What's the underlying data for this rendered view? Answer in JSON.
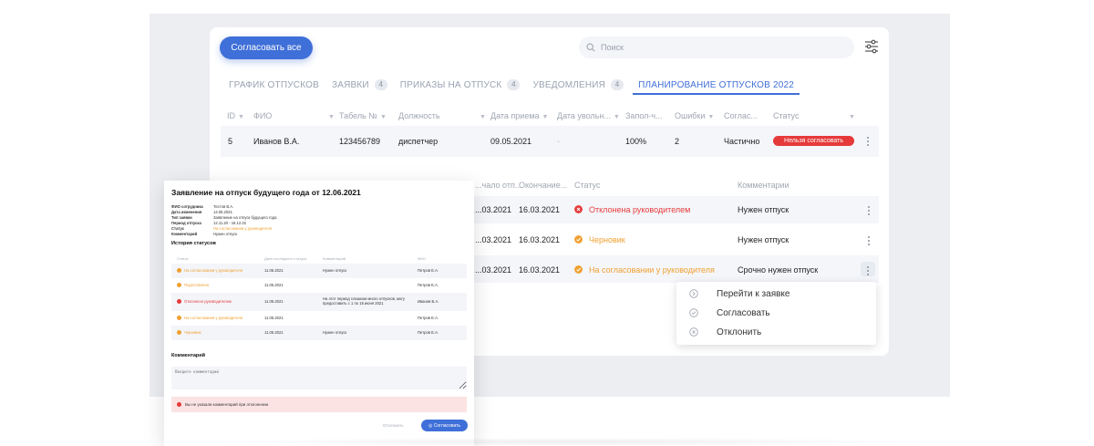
{
  "colors": {
    "accent": "#3f6fd8",
    "danger": "#e63a3a",
    "warning": "#f0a030",
    "stage_bg": "#eceef2"
  },
  "toolbar": {
    "approve_all_label": "Согласовать все",
    "search_placeholder": "Поиск",
    "filter_icon": "filter-sliders-icon"
  },
  "tabs": [
    {
      "label": "ГРАФИК ОТПУСКОВ",
      "badge": ""
    },
    {
      "label": "ЗАЯВКИ",
      "badge": "4"
    },
    {
      "label": "ПРИКАЗЫ НА ОТПУСК",
      "badge": "4"
    },
    {
      "label": "УВЕДОМЛЕНИЯ",
      "badge": "4"
    },
    {
      "label": "ПЛАНИРОВАНИЕ ОТПУСКОВ 2022",
      "badge": ""
    }
  ],
  "table": {
    "headers": [
      "ID",
      "ФИО",
      "Табель №",
      "Должность",
      "Дата приема",
      "Дата увольн...",
      "Запол-ч...",
      "Ошибки",
      "Соглас...",
      "Статус"
    ],
    "row": {
      "id": "5",
      "name": "Иванов В.А.",
      "tabel": "123456789",
      "position": "диспетчер",
      "hire_date": "09.05.2021",
      "fire_date": "-",
      "filled": "100%",
      "errors": "2",
      "agreed": "Частично",
      "status": "Нельзя согласовать"
    }
  },
  "subtable": {
    "headers": [
      "...чало отп...",
      "Окончание...",
      "Статус",
      "Комментарии"
    ],
    "rows": [
      {
        "start": "...03.2021",
        "end": "16.03.2021",
        "status": "Отклонена руководителем",
        "status_type": "rejected",
        "comment": "Нужен отпуск"
      },
      {
        "start": "...03.2021",
        "end": "16.03.2021",
        "status": "Черновик",
        "status_type": "draft",
        "comment": "Нужен отпуск"
      },
      {
        "start": "...03.2021",
        "end": "16.03.2021",
        "status": "На согласовании у руководителя",
        "status_type": "pending",
        "comment": "Срочно нужен отпуск"
      }
    ]
  },
  "context_menu": [
    {
      "label": "Перейти к заявке",
      "icon": "arrow-right-circle-icon"
    },
    {
      "label": "Согласовать",
      "icon": "check-circle-icon"
    },
    {
      "label": "Отклонить",
      "icon": "x-circle-icon"
    }
  ],
  "modal": {
    "title": "Заявление на отпуск будущего года от 12.06.2021",
    "fields": [
      {
        "key": "ФИО сотрудника",
        "value": "Тестов В.А."
      },
      {
        "key": "Дата изменения",
        "value": "14.05.2021"
      },
      {
        "key": "Тип заявки",
        "value": "Заявление на отпуск будущего года"
      },
      {
        "key": "Период отпуска",
        "value": "12.11.20 - 16.12.22"
      },
      {
        "key": "Статус",
        "value": "На согласовании у руководителя"
      },
      {
        "key": "Комментарий",
        "value": "Нужен отпуск"
      }
    ],
    "history_title": "История статусов",
    "history_headers": [
      "Статус",
      "Дата последнего статуса",
      "Комментарий",
      "ФИО"
    ],
    "history": [
      {
        "status": "На согласовании у руководителя",
        "color": "#f0a030",
        "date": "11.05.2021",
        "comment": "Нужен отпуск",
        "fio": "Петров Е.А."
      },
      {
        "status": "Подготовлено",
        "color": "#f0a030",
        "date": "11.05.2021",
        "comment": "",
        "fio": "Петров Е.А."
      },
      {
        "status": "Отклонено руководителем",
        "color": "#e63a3a",
        "date": "11.05.2021",
        "comment": "На этот период слишком много отпусков, могу предоставить с 1 по 16 июня 2021",
        "fio": "Иванов Б.А."
      },
      {
        "status": "На согласовании у руководителя",
        "color": "#f0a030",
        "date": "11.05.2021",
        "comment": "",
        "fio": "Петров Е.А."
      },
      {
        "status": "Черновик",
        "color": "#f0a030",
        "date": "11.05.2021",
        "comment": "Нужен отпуск",
        "fio": "Петров Е.А."
      }
    ],
    "comment_title": "Комментарий",
    "comment_placeholder": "Введите комментарий",
    "error_text": "Вы не указали комментарий при отклонении",
    "cancel_label": "Отклонить",
    "ok_label": "Согласовать"
  }
}
